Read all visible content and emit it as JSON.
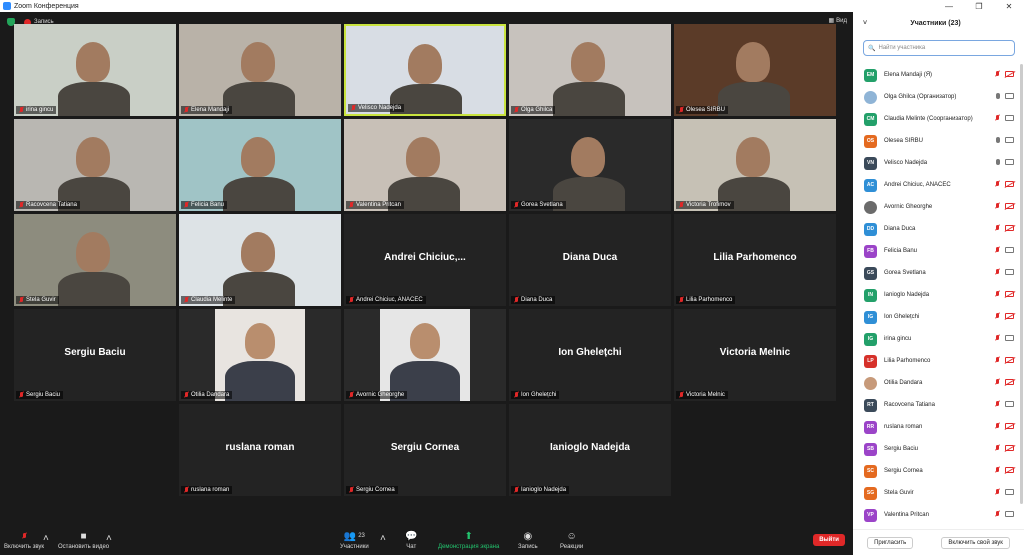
{
  "window": {
    "title": "Zoom Конференция",
    "controls": [
      "—",
      "❐",
      "✕"
    ]
  },
  "top": {
    "record_label": "Запись",
    "view_label": "Вид"
  },
  "tiles": [
    {
      "name": "irina gincu",
      "video": true,
      "bg": "#c9cfc6"
    },
    {
      "name": "Elena Mandaji",
      "video": true,
      "bg": "#b9b2a8"
    },
    {
      "name": "Velisco Nadejda",
      "video": true,
      "bg": "#d8dde4",
      "active": true
    },
    {
      "name": "Olga Ghilca",
      "video": true,
      "bg": "#c7c2bd"
    },
    {
      "name": "Olesea SIRBU",
      "video": true,
      "bg": "#5b3b28"
    },
    {
      "name": "Racovcena Tatiana",
      "video": true,
      "bg": "#b9b7b2"
    },
    {
      "name": "Felicia Banu",
      "video": true,
      "bg": "#a0c4c6"
    },
    {
      "name": "Valentina Pritcan",
      "video": true,
      "bg": "#c8c0b7"
    },
    {
      "name": "Gorea Svetlana",
      "video": true,
      "bg": "#2a2a2a"
    },
    {
      "name": "Victoria Trofimov",
      "video": true,
      "bg": "#c6c1b5"
    },
    {
      "name": "Stela Guvir",
      "video": true,
      "bg": "#8d8c7e"
    },
    {
      "name": "Claudia Melinte",
      "video": true,
      "bg": "#dde3e6"
    },
    {
      "name": "Andrei Chiciuc, ANACEC",
      "big": "Andrei Chiciuc,...",
      "video": false
    },
    {
      "name": "Diana Duca",
      "big": "Diana Duca",
      "video": false
    },
    {
      "name": "Lilia Parhomenco",
      "big": "Lilia Parhomenco",
      "video": false
    },
    {
      "name": "Sergiu Baciu",
      "big": "Sergiu Baciu",
      "video": false
    },
    {
      "name": "Otilia Dandara",
      "video": true,
      "bg": "#2a2a2a",
      "photo": "#e8e4e0"
    },
    {
      "name": "Avornic Gheorghe",
      "video": true,
      "bg": "#2a2a2a",
      "photo": "#e6e6e6"
    },
    {
      "name": "Ion Ghelețchi",
      "big": "Ion Ghelețchi",
      "video": false
    },
    {
      "name": "Victoria Melnic",
      "big": "Victoria Melnic",
      "video": false
    },
    {
      "name": "ruslana roman",
      "big": "ruslana roman",
      "video": false
    },
    {
      "name": "Sergiu Cornea",
      "big": "Sergiu Cornea",
      "video": false
    },
    {
      "name": "Ianioglo Nadejda",
      "big": "Ianioglo Nadejda",
      "video": false
    }
  ],
  "toolbar": {
    "audio_label": "Включить звук",
    "video_label": "Остановить видео",
    "participants_label": "Участники",
    "participants_count": "23",
    "chat_label": "Чат",
    "share_label": "Демонстрация экрана",
    "record_label": "Запись",
    "reactions_label": "Реакции",
    "leave_label": "Выйти"
  },
  "panel": {
    "title": "Участники (23)",
    "search_placeholder": "Найти участника",
    "invite_label": "Пригласить",
    "unmute_label": "Включить свой звук",
    "participants": [
      {
        "initials": "EM",
        "name": "Elena Mandaji (Я)",
        "color": "#23a06a",
        "mic": "off",
        "cam": "off"
      },
      {
        "initials": "",
        "name": "Olga Ghilca (Организатор)",
        "color": "#8fb4d6",
        "mic": "on",
        "cam": "on",
        "photo": true
      },
      {
        "initials": "CM",
        "name": "Claudia Melinte (Соорганизатор)",
        "color": "#23a06a",
        "mic": "off",
        "cam": "on"
      },
      {
        "initials": "OS",
        "name": "Olesea SIRBU",
        "color": "#e46a20",
        "mic": "on",
        "cam": "on"
      },
      {
        "initials": "VN",
        "name": "Velisco Nadejda",
        "color": "#3b4a5a",
        "mic": "on",
        "cam": "on"
      },
      {
        "initials": "AC",
        "name": "Andrei Chiciuc, ANACEC",
        "color": "#2f8fd6",
        "mic": "off",
        "cam": "off"
      },
      {
        "initials": "",
        "name": "Avornic Gheorghe",
        "color": "#6b6b6b",
        "mic": "off",
        "cam": "off",
        "photo": true
      },
      {
        "initials": "DD",
        "name": "Diana Duca",
        "color": "#2f8fd6",
        "mic": "off",
        "cam": "off"
      },
      {
        "initials": "FB",
        "name": "Felicia Banu",
        "color": "#9b44c8",
        "mic": "off",
        "cam": "on"
      },
      {
        "initials": "GS",
        "name": "Gorea Svetlana",
        "color": "#3b4a5a",
        "mic": "off",
        "cam": "on"
      },
      {
        "initials": "IN",
        "name": "Ianioglo Nadejda",
        "color": "#23a06a",
        "mic": "off",
        "cam": "off"
      },
      {
        "initials": "IG",
        "name": "Ion Ghelețchi",
        "color": "#2f8fd6",
        "mic": "off",
        "cam": "off"
      },
      {
        "initials": "IG",
        "name": "irina gincu",
        "color": "#23a06a",
        "mic": "off",
        "cam": "on"
      },
      {
        "initials": "LP",
        "name": "Lilia Parhomenco",
        "color": "#d6312a",
        "mic": "off",
        "cam": "off"
      },
      {
        "initials": "",
        "name": "Otilia Dandara",
        "color": "#c79a7a",
        "mic": "off",
        "cam": "off",
        "photo": true
      },
      {
        "initials": "RT",
        "name": "Racovcena Tatiana",
        "color": "#3b4a5a",
        "mic": "off",
        "cam": "on"
      },
      {
        "initials": "RR",
        "name": "ruslana roman",
        "color": "#9b44c8",
        "mic": "off",
        "cam": "off"
      },
      {
        "initials": "SB",
        "name": "Sergiu Baciu",
        "color": "#9b44c8",
        "mic": "off",
        "cam": "off"
      },
      {
        "initials": "SC",
        "name": "Sergiu Cornea",
        "color": "#e46a20",
        "mic": "off",
        "cam": "off"
      },
      {
        "initials": "SG",
        "name": "Stela Guvir",
        "color": "#e46a20",
        "mic": "off",
        "cam": "on"
      },
      {
        "initials": "VP",
        "name": "Valentina Pritcan",
        "color": "#9b44c8",
        "mic": "off",
        "cam": "on"
      }
    ]
  }
}
